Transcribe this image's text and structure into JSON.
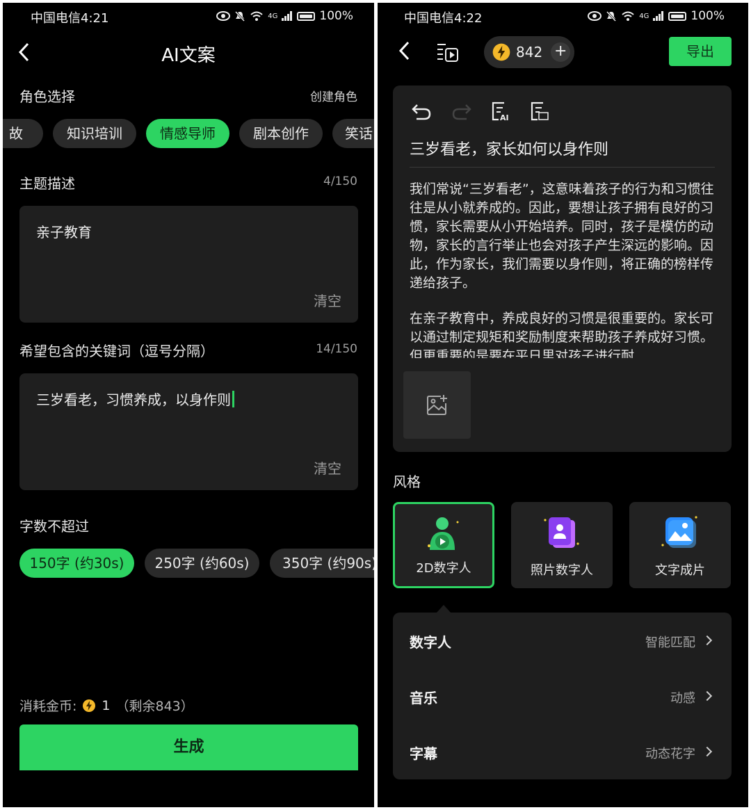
{
  "left": {
    "status": {
      "carrier_time": "中国电信4:21",
      "battery": "100%",
      "network": "4G"
    },
    "title": "AI文案",
    "role": {
      "label": "角色选择",
      "create": "创建角色",
      "chips": [
        "故",
        "知识培训",
        "情感导师",
        "剧本创作",
        "笑话"
      ],
      "active": "情感导师"
    },
    "topic": {
      "label": "主题描述",
      "count": "4/150",
      "value": "亲子教育",
      "clear": "清空"
    },
    "keywords": {
      "label": "希望包含的关键词（逗号分隔）",
      "count": "14/150",
      "value": "三岁看老，习惯养成，以身作则",
      "clear": "清空"
    },
    "length": {
      "label": "字数不超过",
      "options": [
        "150字 (约30s)",
        "250字 (约60s)",
        "350字 (约90s)"
      ],
      "active": "150字 (约30s)"
    },
    "cost": {
      "label": "消耗金币:",
      "amount": "1",
      "remaining": "（剩余843）"
    },
    "generate": "生成"
  },
  "right": {
    "status": {
      "carrier_time": "中国电信4:22",
      "battery": "100%",
      "network": "4G"
    },
    "coins": "842",
    "export": "导出",
    "editor": {
      "title": "三岁看老，家长如何以身作则",
      "paragraphs": [
        "我们常说“三岁看老”，这意味着孩子的行为和习惯往往是从小就养成的。因此，要想让孩子拥有良好的习惯，家长需要从小开始培养。同时，孩子是模仿的动物，家长的言行举止也会对孩子产生深远的影响。因此，作为家长，我们需要以身作则，将正确的榜样传递给孩子。",
        "在亲子教育中，养成良好的习惯是很重要的。家长可以通过制定规矩和奖励制度来帮助孩子养成好习惯。但更重要的是要在平日里对孩子进行耐"
      ]
    },
    "style": {
      "label": "风格",
      "options": [
        "2D数字人",
        "照片数字人",
        "文字成片"
      ],
      "selected": "2D数字人"
    },
    "settings": [
      {
        "name": "数字人",
        "value": "智能匹配"
      },
      {
        "name": "音乐",
        "value": "动感"
      },
      {
        "name": "字幕",
        "value": "动态花字"
      }
    ],
    "colors": {
      "accent": "#2dd462",
      "background": "#000000",
      "card": "#1e1e1e"
    },
    "icons": [
      "undo-icon",
      "redo-icon",
      "ai-rewrite-icon",
      "edit-text-icon",
      "add-image-icon",
      "script-list-icon",
      "lightning-coin-icon",
      "plus-icon"
    ]
  }
}
